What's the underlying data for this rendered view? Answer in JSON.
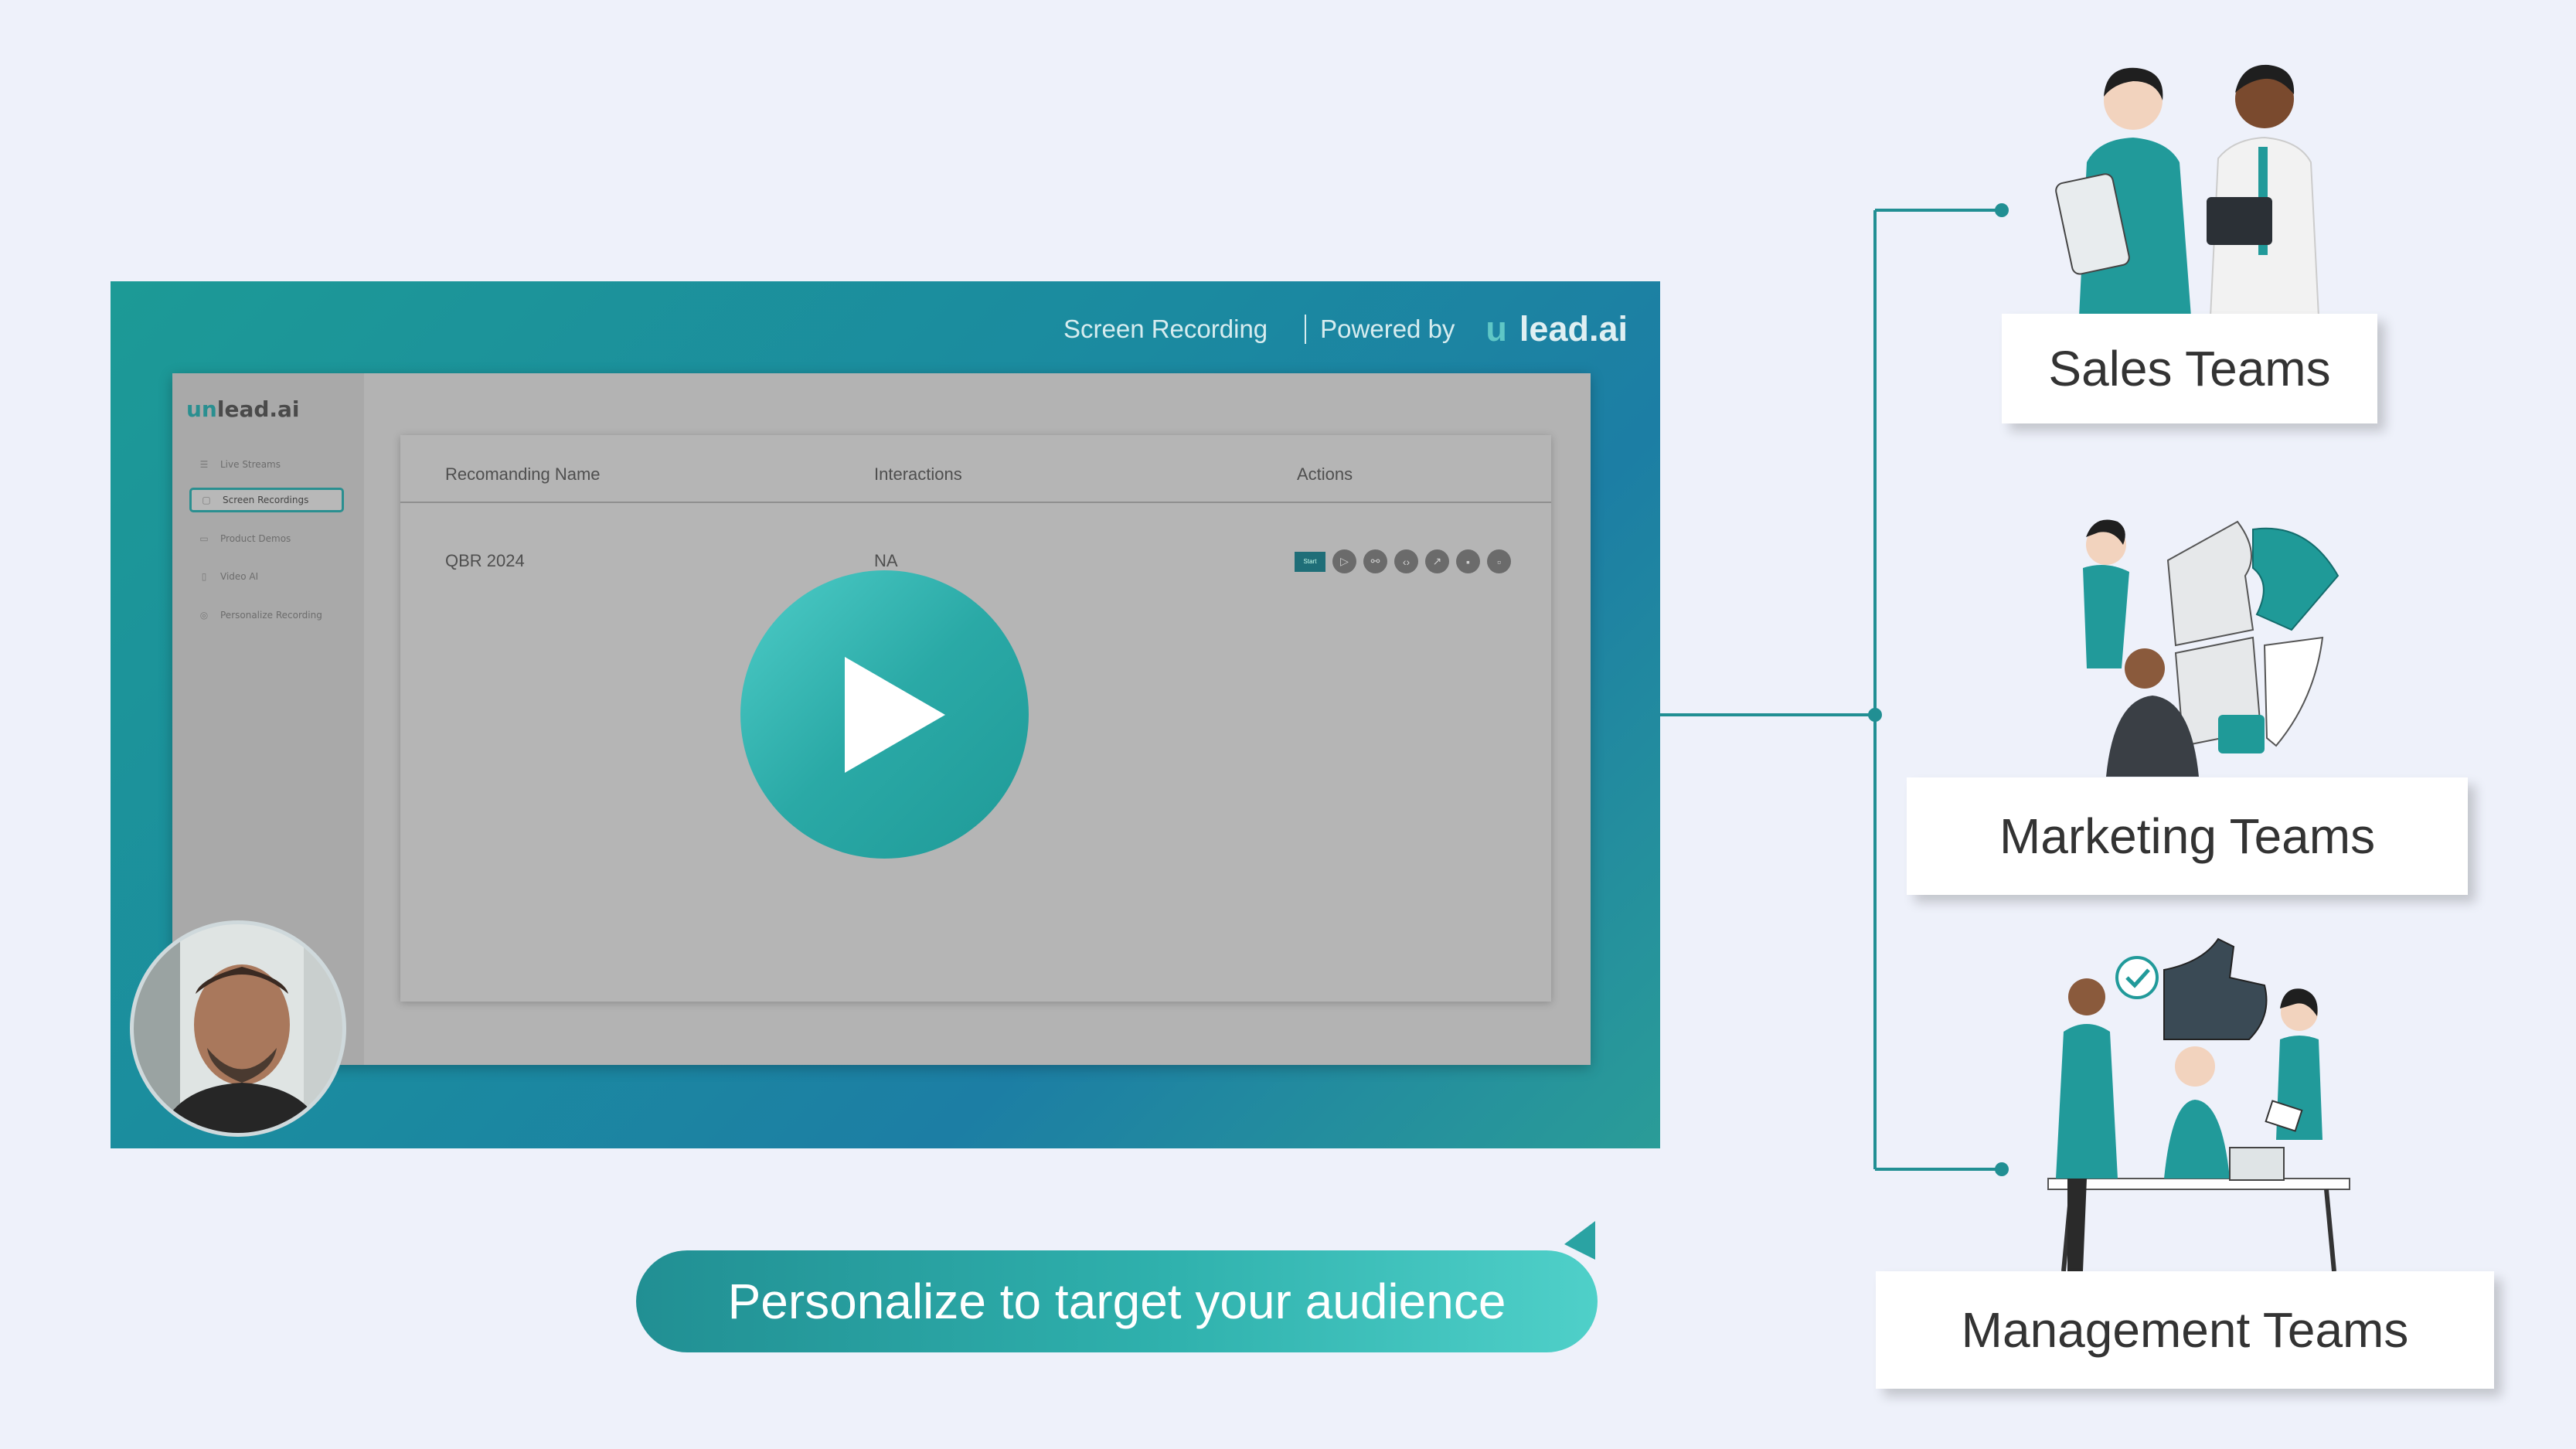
{
  "video": {
    "header_title": "Screen Recording",
    "powered_by": "Powered by",
    "brand_prefix": "u",
    "brand_name": "lead.ai"
  },
  "app": {
    "logo_prefix": "un",
    "logo_name": "lead.ai",
    "sidebar": {
      "items": [
        {
          "label": "Live Streams",
          "icon": "list-icon"
        },
        {
          "label": "Screen Recordings",
          "icon": "screen-icon",
          "active": true
        },
        {
          "label": "Product Demos",
          "icon": "camera-icon"
        },
        {
          "label": "Video AI",
          "icon": "document-icon"
        },
        {
          "label": "Personalize Recording",
          "icon": "target-icon"
        }
      ]
    },
    "table": {
      "headers": [
        "Recomanding Name",
        "Interactions",
        "Actions"
      ],
      "rows": [
        {
          "name": "QBR 2024",
          "interactions": "NA",
          "start_label": "Start"
        }
      ]
    }
  },
  "caption": "Personalize to target your audience",
  "teams": [
    {
      "label": "Sales Teams"
    },
    {
      "label": "Marketing Teams"
    },
    {
      "label": "Management Teams"
    }
  ],
  "colors": {
    "teal": "#2aa9a6",
    "teal_dark": "#1f8f93",
    "background": "#eef1fa"
  }
}
